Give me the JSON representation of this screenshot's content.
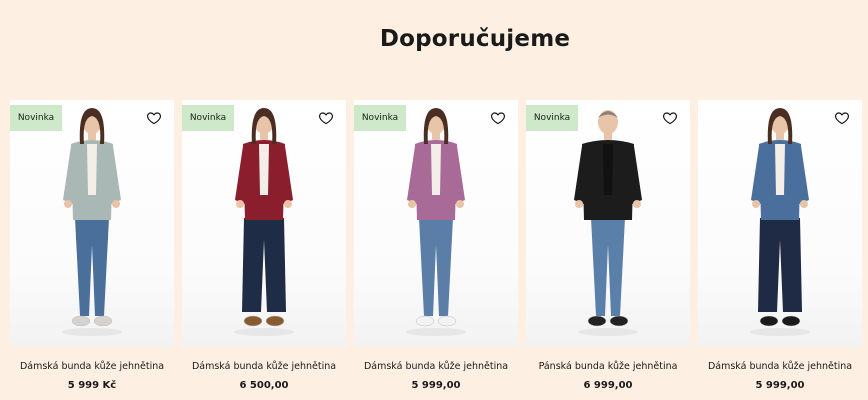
{
  "section": {
    "title": "Doporučujeme"
  },
  "colors": {
    "page_bg": "#fdf0e3",
    "badge_bg": "#cde9c9"
  },
  "products": [
    {
      "badge": "Novinka",
      "name": "Dámská bunda kůže jehnětina",
      "price": "5 999 Kč",
      "jacket_color": "#aab8b5",
      "pants_color": "#4a6f9a",
      "shoe_color": "#d5d2cf",
      "icon": "heart-outline-icon"
    },
    {
      "badge": "Novinka",
      "name": "Dámská bunda kůže jehnětina",
      "price": "6 500,00",
      "jacket_color": "#8b1e2c",
      "pants_color": "#1f2c45",
      "shoe_color": "#8a5a32",
      "icon": "heart-outline-icon"
    },
    {
      "badge": "Novinka",
      "name": "Dámská bunda kůže jehnětina",
      "price": "5 999,00",
      "jacket_color": "#a86a96",
      "pants_color": "#5a7ea8",
      "shoe_color": "#f2f2f2",
      "icon": "heart-outline-icon"
    },
    {
      "badge": "Novinka",
      "name": "Pánská bunda kůže jehnětina",
      "price": "6 999,00",
      "jacket_color": "#1c1c1c",
      "pants_color": "#5a80aa",
      "shoe_color": "#222222",
      "icon": "heart-outline-icon"
    },
    {
      "badge": "",
      "name": "Dámská bunda kůže jehnětina",
      "price": "5 999,00",
      "jacket_color": "#4a6f9c",
      "pants_color": "#1f2a44",
      "shoe_color": "#1a1a1a",
      "icon": "heart-outline-icon"
    }
  ]
}
